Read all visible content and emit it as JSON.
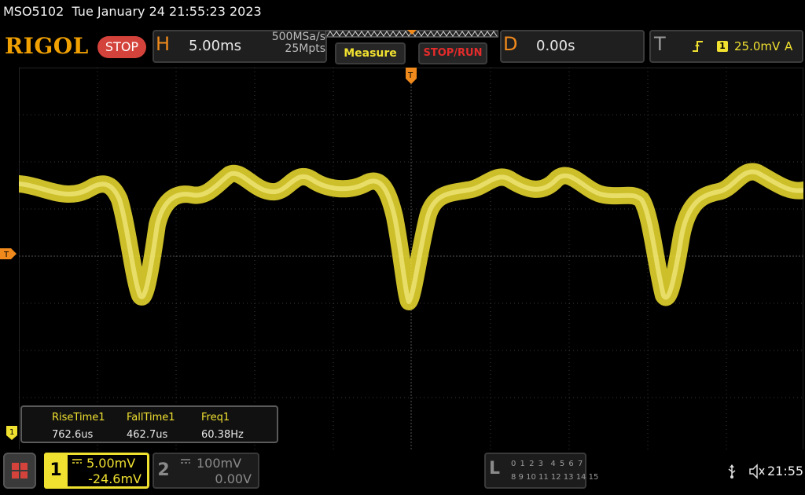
{
  "titlebar": {
    "model": "MSO5102",
    "datetime": "Tue January 24 21:55:23 2023"
  },
  "topbar": {
    "brand": "RIGOL",
    "status": "STOP",
    "horizontal": {
      "label": "H",
      "timebase": "5.00ms",
      "sample_rate": "500MSa/s",
      "memory_depth": "25Mpts"
    },
    "measure_button": "Measure",
    "stoprun_button": "STOP/RUN",
    "delay": {
      "label": "D",
      "value": "0.00s"
    },
    "trigger": {
      "label": "T",
      "slope_icon": "rising-edge-icon",
      "channel": "1",
      "level": "25.0mV",
      "mode": "A"
    }
  },
  "markers": {
    "ch1_level": "T",
    "trigger_top": "T",
    "ch1_ground": "1"
  },
  "measurements": [
    {
      "label": "RiseTime1",
      "value": "762.6us"
    },
    {
      "label": "FallTime1",
      "value": "462.7us"
    },
    {
      "label": "Freq1",
      "value": "60.38Hz"
    }
  ],
  "channels": {
    "ch1": {
      "number": "1",
      "scale": "5.00mV",
      "offset": "-24.6mV",
      "color": "#f0e030"
    },
    "ch2": {
      "number": "2",
      "scale": "100mV",
      "offset": "0.00V",
      "color": "#8a8a8a"
    }
  },
  "logic_analyzer": {
    "label": "L",
    "row1": "0 1 2 3  4 5 6 7",
    "row2": "8 9 10 11 12 13 14 15"
  },
  "status_icons": [
    "usb-icon",
    "speaker-muted-icon"
  ],
  "clock": "21:55",
  "colors": {
    "trace": "#f0e030",
    "brand": "#f0a000",
    "accent": "#f08a1c",
    "stop": "#d4433b"
  }
}
